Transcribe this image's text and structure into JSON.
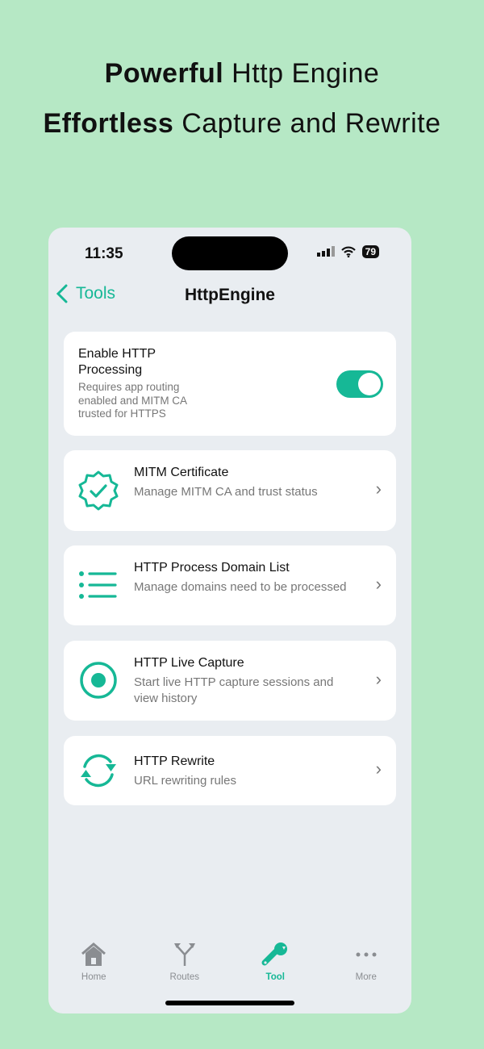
{
  "headline": {
    "line1_bold": "Powerful",
    "line1_rest": " Http Engine",
    "line2_bold": "Effortless",
    "line2_rest": " Capture and Rewrite"
  },
  "status": {
    "time": "11:35",
    "battery": "79"
  },
  "nav": {
    "back_label": "Tools",
    "title": "HttpEngine"
  },
  "toggle_card": {
    "title": "Enable HTTP Processing",
    "subtitle": "Requires app routing enabled and MITM CA trusted for HTTPS",
    "enabled": true
  },
  "items": [
    {
      "title": "MITM Certificate",
      "subtitle": "Manage MITM CA and trust status",
      "icon": "certificate-badge-icon"
    },
    {
      "title": "HTTP Process Domain List",
      "subtitle": "Manage domains need to be processed",
      "icon": "list-icon"
    },
    {
      "title": "HTTP Live Capture",
      "subtitle": "Start live HTTP capture sessions and view history",
      "icon": "record-icon"
    },
    {
      "title": "HTTP Rewrite",
      "subtitle": "URL rewriting rules",
      "icon": "refresh-icon"
    }
  ],
  "tabs": [
    {
      "label": "Home"
    },
    {
      "label": "Routes"
    },
    {
      "label": "Tool",
      "active": true
    },
    {
      "label": "More"
    }
  ],
  "colors": {
    "accent": "#16b896",
    "background": "#b6e8c5"
  }
}
